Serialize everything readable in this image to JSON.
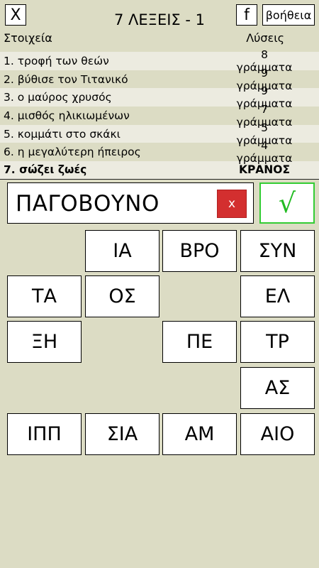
{
  "header": {
    "close_label": "X",
    "facebook_label": "f",
    "help_label": "βοήθεια",
    "title": "7 ΛΕΞΕΙΣ - 1",
    "col_left": "Στοιχεία",
    "col_right": "Λύσεις"
  },
  "clues": [
    {
      "text": "1. τροφή των θεών",
      "answer": "8 γράμματα"
    },
    {
      "text": "2. βύθισε τον Τιτανικό",
      "answer": "9 γράμματα"
    },
    {
      "text": "3. ο μαύρος χρυσός",
      "answer": "9 γράμματα"
    },
    {
      "text": "4. μισθός ηλικιωμένων",
      "answer": "7 γράμματα"
    },
    {
      "text": "5. κομμάτι στο σκάκι",
      "answer": "5 γράμματα"
    },
    {
      "text": "6. η μεγαλύτερη ήπειρος",
      "answer": "4 γράμματα"
    },
    {
      "text": "7. σώζει ζωές",
      "answer": "ΚΡΑΝΟΣ"
    }
  ],
  "answer": {
    "value": "ΠΑΓΟΒΟΥΝΟ",
    "clear_label": "x",
    "confirm_label": "√"
  },
  "tiles": {
    "r1c2": "ΙΑ",
    "r1c3": "ΒΡΟ",
    "r1c4": "ΣΥΝ",
    "r2c1": "ΤΑ",
    "r2c2": "ΟΣ",
    "r2c4": "ΕΛ",
    "r3c1": "ΞΗ",
    "r3c3": "ΠΕ",
    "r3c4": "ΤΡ",
    "r4c4": "ΑΣ",
    "r5c1": "ΙΠΠ",
    "r5c2": "ΣΙΑ",
    "r5c3": "ΑΜ",
    "r5c4": "ΑΙΟ"
  },
  "colors": {
    "background": "#dcdcc4",
    "row_light": "#ecebe0",
    "clear_red": "#d32f2f",
    "confirm_green": "#33cc33"
  }
}
